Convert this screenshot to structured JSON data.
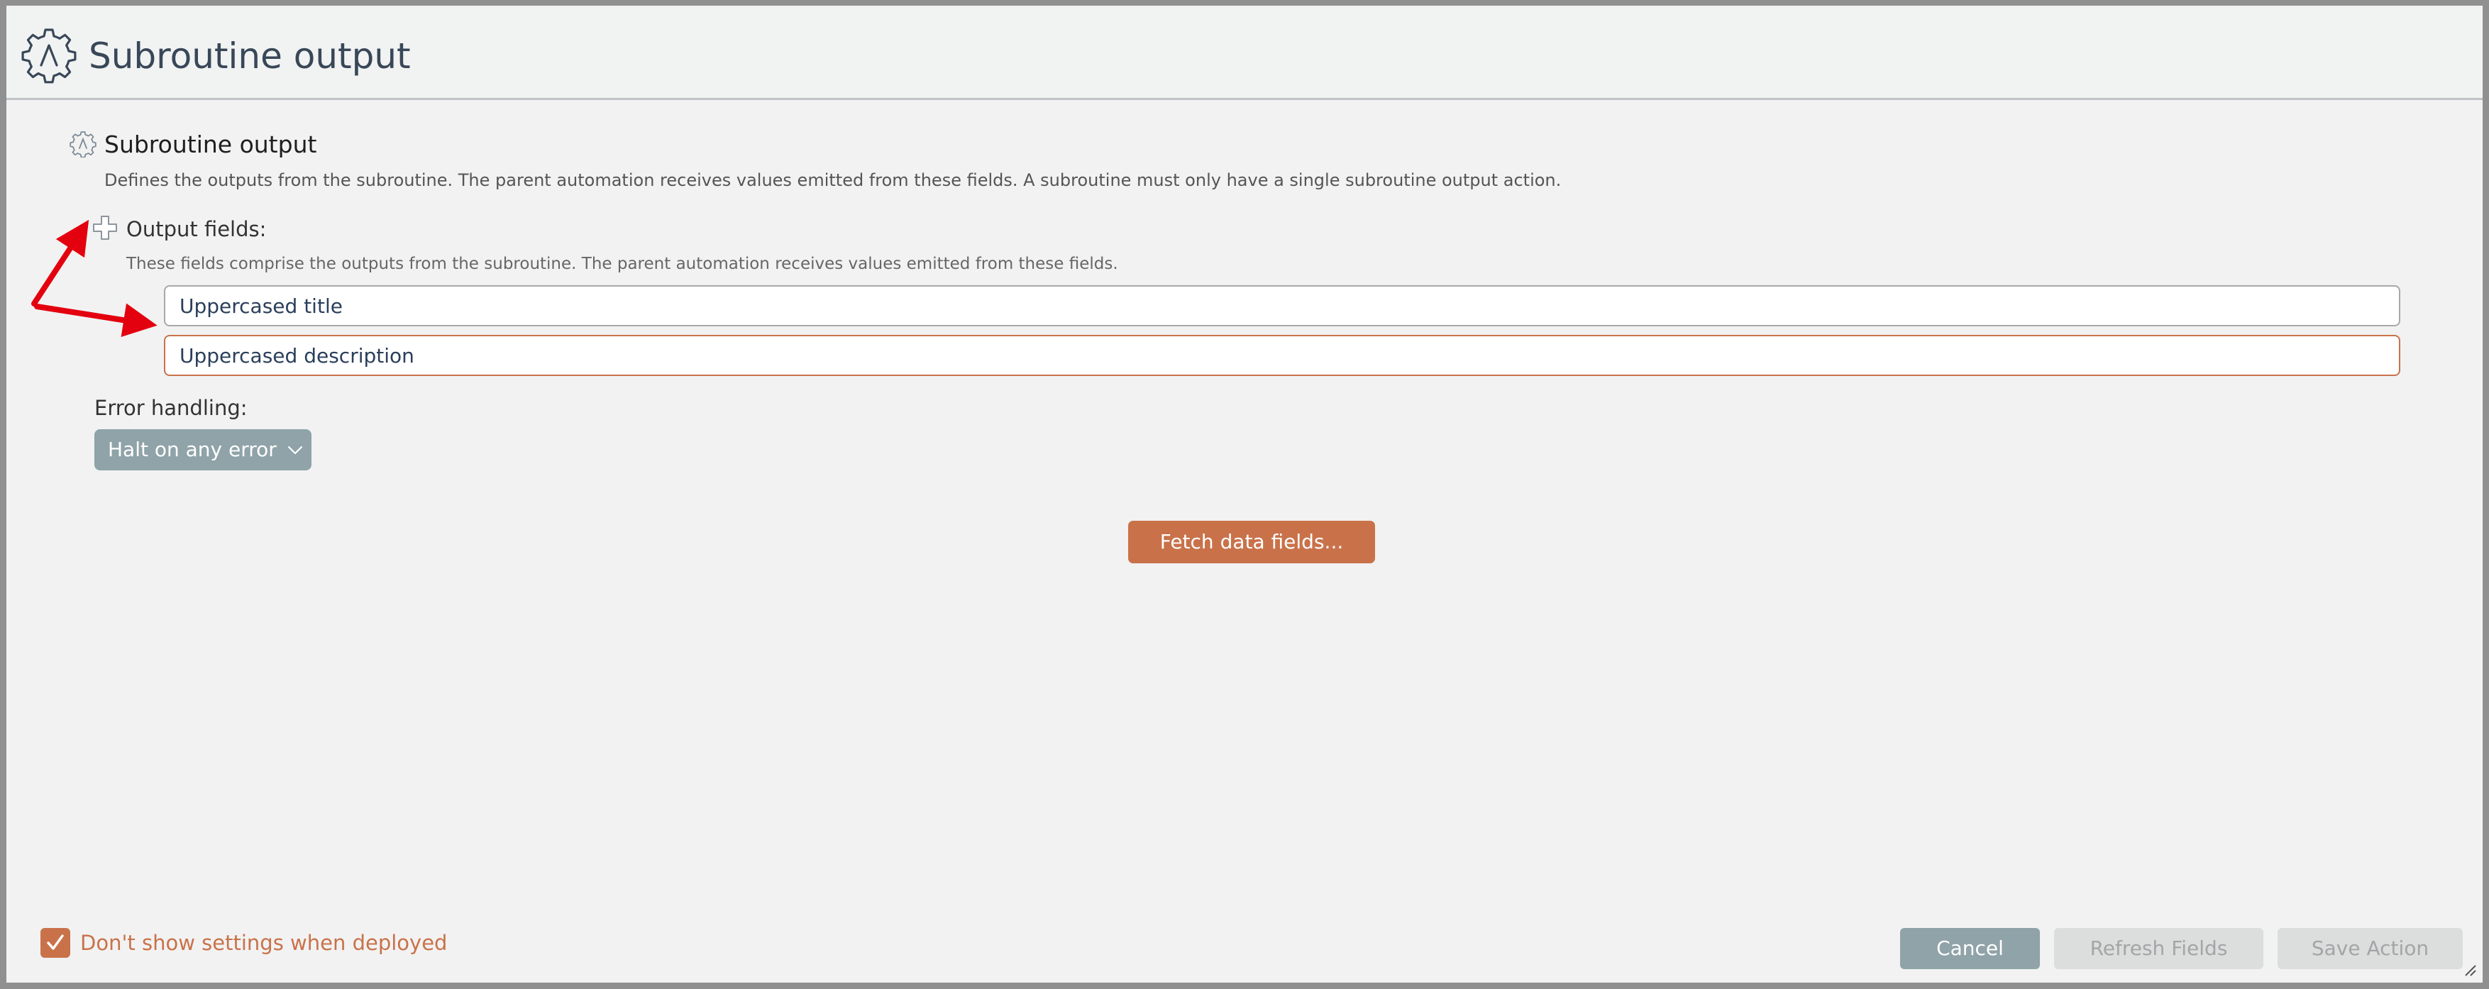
{
  "window": {
    "title": "Subroutine output",
    "icon": "subroutine-gear-icon"
  },
  "section": {
    "title": "Subroutine output",
    "description": "Defines the outputs from the subroutine.  The parent automation receives values emitted from these fields.  A subroutine must only have a single subroutine output action."
  },
  "output_fields": {
    "label": "Output fields:",
    "description": "These fields comprise the outputs from the subroutine.  The parent automation receives values emitted from these fields.",
    "add_icon": "plus-icon",
    "fields": [
      {
        "value": "Uppercased title"
      },
      {
        "value": "Uppercased description"
      }
    ]
  },
  "error_handling": {
    "label": "Error handling:",
    "selected": "Halt on any error"
  },
  "fetch_button": "Fetch data fields...",
  "footer": {
    "dont_show_label": "Don't show settings when deployed",
    "dont_show_checked": true,
    "cancel": "Cancel",
    "refresh": "Refresh Fields",
    "save": "Save Action"
  },
  "colors": {
    "accent": "#c9724a",
    "header_text": "#384758",
    "select_bg": "#8fa3a8",
    "annotation_arrow": "#e3000f"
  }
}
